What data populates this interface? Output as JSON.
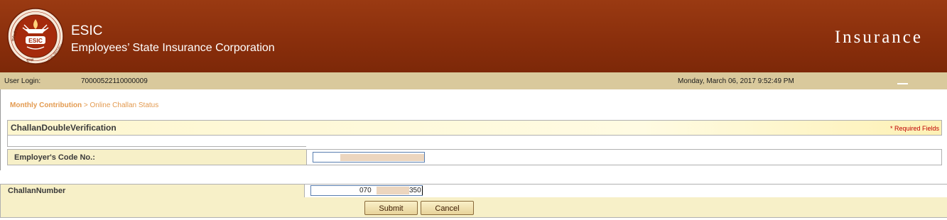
{
  "header": {
    "abbr": "ESIC",
    "org_name": "Employees’ State Insurance Corporation",
    "brand": "Insurance",
    "logo": {
      "text": "ESIC",
      "ring_left": "कर्मचारी राज्य",
      "ring_right": "SOCIAL SECURITY",
      "ring_bottom": "सुरक्षा"
    }
  },
  "userbar": {
    "login_label": "User Login:",
    "login_value": "70000522110000009",
    "datetime": "Monday, March 06, 2017 9:52:49 PM",
    "minimize_icon": "minimize-icon"
  },
  "breadcrumb": {
    "parent": "Monthly Contribution",
    "separator": ">",
    "current": "Online Challan Status"
  },
  "form": {
    "section_title": "ChallanDoubleVerification",
    "required_note": "* Required Fields",
    "employer_code_label": "Employer's Code No.:",
    "employer_code_value": "",
    "challan_label": "ChallanNumber",
    "challan_value_prefix": "070",
    "challan_value_suffix": "350",
    "submit_label": "Submit",
    "cancel_label": "Cancel"
  },
  "colors": {
    "header_bg": "#8a2f0c",
    "userbar_bg": "#d9c99c",
    "breadcrumb": "#e39a4f",
    "required": "#c00000",
    "label_cell": "#f7f0c8"
  }
}
